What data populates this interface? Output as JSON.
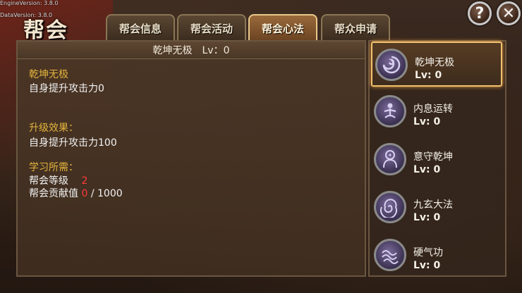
{
  "version": {
    "engine": "EngineVersion: 3.8.0",
    "data": "DataVersion: 3.8.0"
  },
  "header": {
    "title": "帮会",
    "help_label": "?",
    "close_label": "✕"
  },
  "tabs": [
    {
      "label": "帮会信息",
      "active": false
    },
    {
      "label": "帮会活动",
      "active": false
    },
    {
      "label": "帮会心法",
      "active": true
    },
    {
      "label": "帮众申请",
      "active": false
    }
  ],
  "detail": {
    "header": "乾坤无极　Lv：0",
    "skill_name": "乾坤无极",
    "current_effect": "自身提升攻击力0",
    "upgrade_title": "升级效果：",
    "upgrade_effect": "自身提升攻击力100",
    "req_title": "学习所需：",
    "req_guild_level_label": "帮会等级",
    "req_guild_level_value": "2",
    "req_contrib_label": "帮会贡献值",
    "req_contrib_current": "0",
    "req_contrib_sep": "/",
    "req_contrib_total": "1000"
  },
  "skills": [
    {
      "name": "乾坤无极",
      "level": "Lv: 0",
      "icon": "swirl-icon",
      "selected": true
    },
    {
      "name": "内息运转",
      "level": "Lv: 0",
      "icon": "meditation-icon",
      "selected": false
    },
    {
      "name": "意守乾坤",
      "level": "Lv: 0",
      "icon": "buddha-icon",
      "selected": false
    },
    {
      "name": "九玄大法",
      "level": "Lv: 0",
      "icon": "spiral-icon",
      "selected": false
    },
    {
      "name": "硬气功",
      "level": "Lv: 0",
      "icon": "wave-icon",
      "selected": false
    }
  ],
  "colors": {
    "gold_text": "#e2b33c",
    "requirement_unmet": "#ff3a3a",
    "active_tab": "#9a6a3a"
  }
}
